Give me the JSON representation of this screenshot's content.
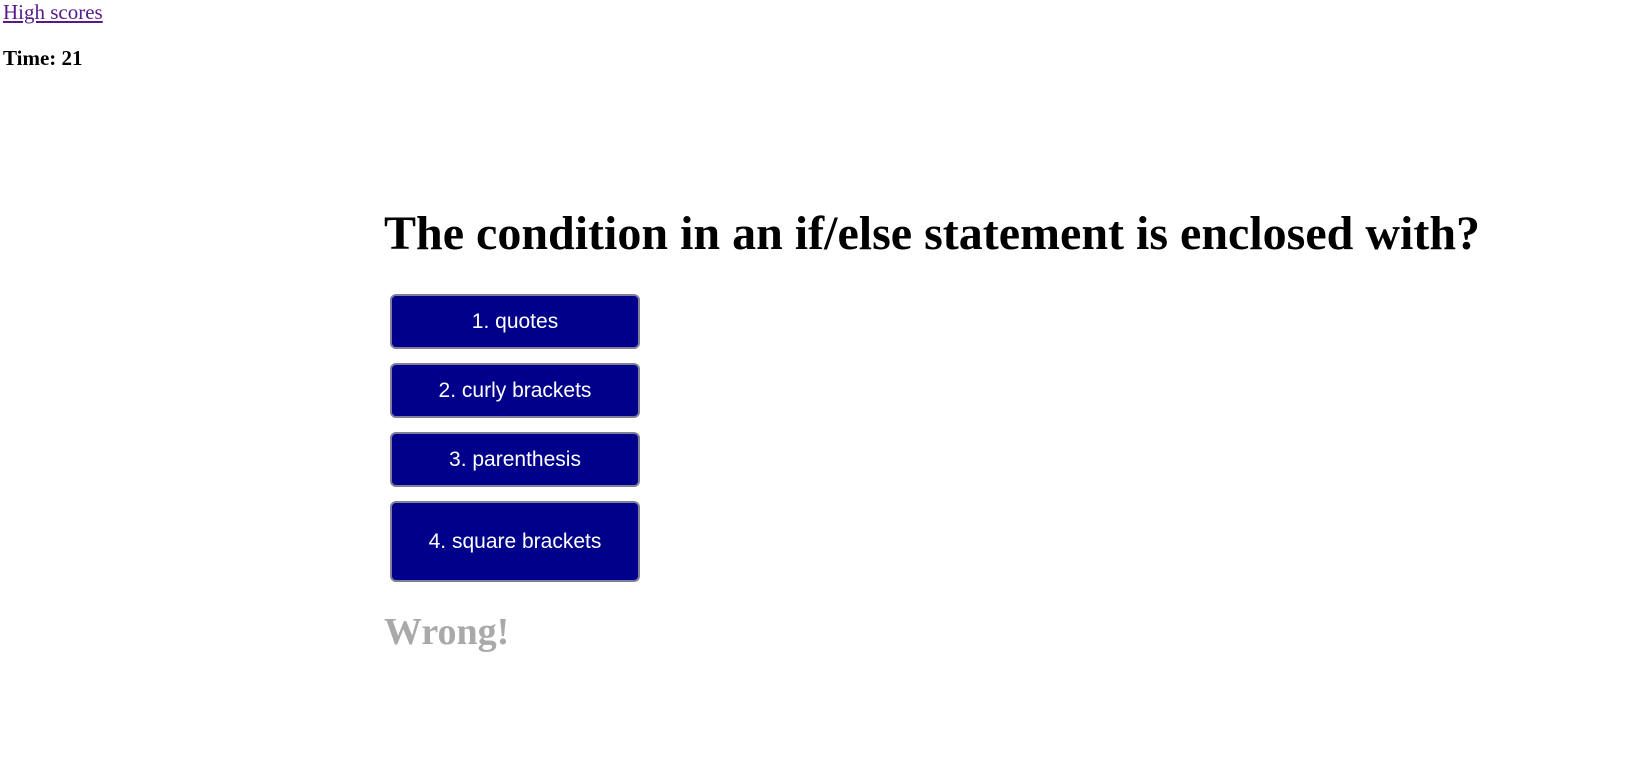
{
  "nav": {
    "high_scores_link": "High scores"
  },
  "timer": {
    "text": "Time: 21"
  },
  "quiz": {
    "question": "The condition in an if/else statement is enclosed with?",
    "answers": [
      {
        "label": "1. quotes"
      },
      {
        "label": "2. curly brackets"
      },
      {
        "label": "3. parenthesis"
      },
      {
        "label": "4. square brackets"
      }
    ],
    "feedback": "Wrong!"
  },
  "colors": {
    "button_background": "#00008b",
    "button_text": "#ffffff",
    "feedback_text": "#a9a9a9",
    "link": "#551a8b"
  }
}
